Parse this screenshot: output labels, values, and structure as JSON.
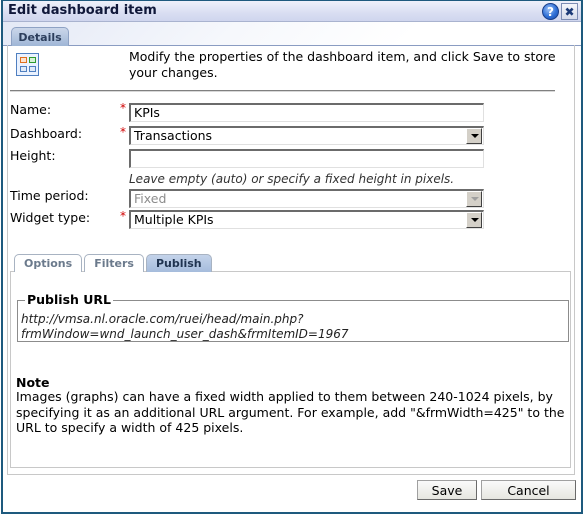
{
  "dialog": {
    "title": "Edit dashboard item",
    "help_icon": "help-icon",
    "close_icon": "close-icon",
    "help_glyph": "?",
    "close_glyph": "✖"
  },
  "tabs": {
    "top": [
      {
        "label": "Details",
        "active": true
      }
    ]
  },
  "intro": {
    "icon": "dashboard-icon",
    "text": "Modify the properties of the dashboard item, and click Save to store your changes."
  },
  "form": {
    "name": {
      "label": "Name:",
      "required": true,
      "value": "KPIs"
    },
    "dashboard": {
      "label": "Dashboard:",
      "required": true,
      "value": "Transactions"
    },
    "height": {
      "label": "Height:",
      "required": false,
      "value": "",
      "hint": "Leave empty (auto) or specify a fixed height in pixels."
    },
    "time_period": {
      "label": "Time period:",
      "required": false,
      "value": "Fixed",
      "disabled": true
    },
    "widget_type": {
      "label": "Widget type:",
      "required": true,
      "value": "Multiple KPIs"
    },
    "required_marker": "*"
  },
  "subtabs": [
    {
      "label": "Options",
      "active": false
    },
    {
      "label": "Filters",
      "active": false
    },
    {
      "label": "Publish",
      "active": true
    }
  ],
  "publish": {
    "legend": "Publish URL",
    "url_line1": "http://vmsa.nl.oracle.com/ruei/head/main.php?",
    "url_line2": "frmWindow=wnd_launch_user_dash&frmItemID=1967"
  },
  "note": {
    "title": "Note",
    "text": "Images (graphs) can have a fixed width applied to them between 240-1024 pixels, by specifying it as an additional URL argument. For example, add \"&frmWidth=425\" to the URL to specify a width of 425 pixels."
  },
  "buttons": {
    "save": "Save",
    "cancel": "Cancel"
  },
  "colors": {
    "border": "#1e5a7e",
    "required": "#d00000",
    "active_tab": "#a5bcdc"
  }
}
